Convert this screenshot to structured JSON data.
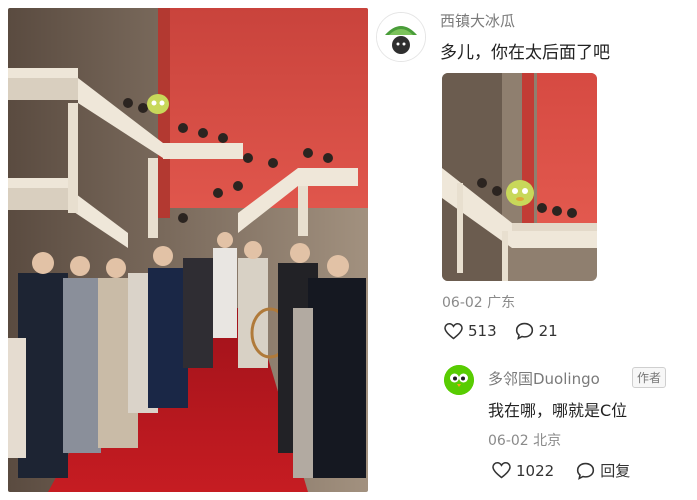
{
  "comment1": {
    "username": "西镇大冰瓜",
    "text": "多儿，你在太后面了吧",
    "date": "06-02",
    "location": "广东",
    "likes": "513",
    "replies": "21"
  },
  "comment2": {
    "username": "多邻国Duolingo",
    "badge": "作者",
    "text": "我在哪，哪就是C位",
    "date": "06-02",
    "location": "北京",
    "likes": "1022",
    "reply_label": "回复"
  },
  "colors": {
    "red_wall": "#d7463f",
    "carpet": "#b8141b",
    "duolingo_green": "#58cc02",
    "meta_gray": "#8a8a8a"
  },
  "icons": [
    "heart-icon",
    "comment-icon",
    "duolingo-owl-avatar"
  ]
}
